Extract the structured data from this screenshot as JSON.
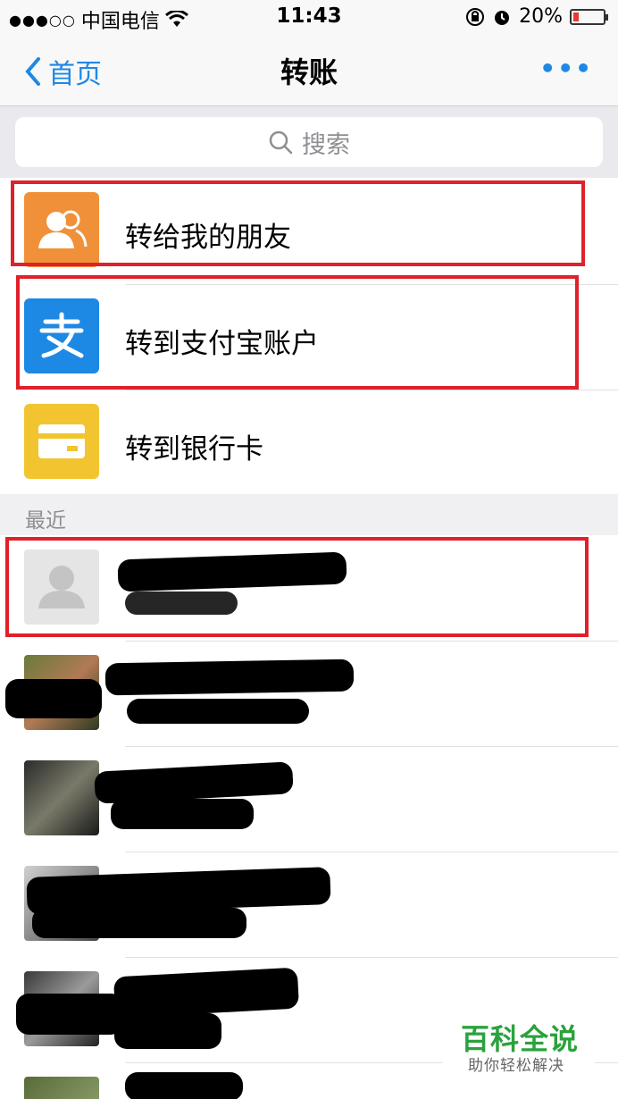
{
  "status_bar": {
    "carrier": "中国电信",
    "time": "11:43",
    "battery": "20%",
    "battery_level": 0.2,
    "signal_icon": "signal-dots-icon",
    "wifi_icon": "wifi-icon",
    "lock_icon": "rotation-lock-icon",
    "alarm_icon": "alarm-icon"
  },
  "nav": {
    "back_label": "首页",
    "title": "转账",
    "more_icon": "more-dots-icon",
    "accent_color": "#1e88e5"
  },
  "search": {
    "placeholder": "搜索",
    "icon": "search-icon"
  },
  "menu": [
    {
      "label": "转给我的朋友",
      "icon": "friends-icon",
      "color": "#f0913a"
    },
    {
      "label": "转到支付宝账户",
      "icon": "alipay-icon",
      "color": "#1e88e5"
    },
    {
      "label": "转到银行卡",
      "icon": "bank-card-icon",
      "color": "#f2c530"
    }
  ],
  "recent": {
    "header": "最近"
  },
  "highlight_color": "#e0202a",
  "watermark": {
    "title": "百科全说",
    "subtitle": "助你轻松解决"
  }
}
